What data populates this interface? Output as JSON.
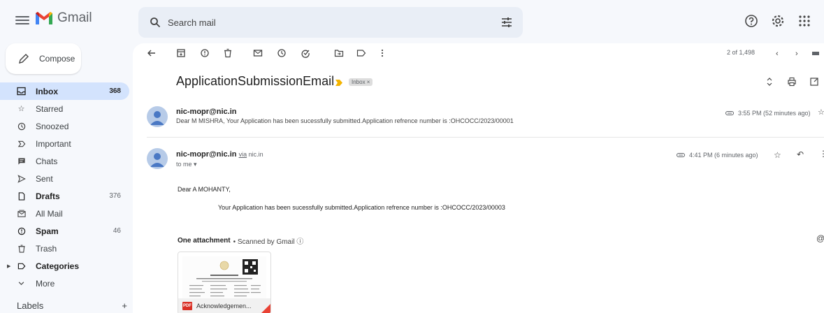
{
  "app": {
    "name": "Gmail"
  },
  "search": {
    "placeholder": "Search mail"
  },
  "compose": {
    "label": "Compose"
  },
  "sidebar": {
    "items": [
      {
        "label": "Inbox",
        "count": "368",
        "icon": "inbox-icon"
      },
      {
        "label": "Starred",
        "count": "",
        "icon": "star-icon"
      },
      {
        "label": "Snoozed",
        "count": "",
        "icon": "clock-icon"
      },
      {
        "label": "Important",
        "count": "",
        "icon": "important-icon"
      },
      {
        "label": "Chats",
        "count": "",
        "icon": "chat-icon"
      },
      {
        "label": "Sent",
        "count": "",
        "icon": "send-icon"
      },
      {
        "label": "Drafts",
        "count": "376",
        "icon": "draft-icon"
      },
      {
        "label": "All Mail",
        "count": "",
        "icon": "all-mail-icon"
      },
      {
        "label": "Spam",
        "count": "46",
        "icon": "spam-icon"
      },
      {
        "label": "Trash",
        "count": "",
        "icon": "trash-icon"
      },
      {
        "label": "Categories",
        "count": "",
        "icon": "label-icon"
      },
      {
        "label": "More",
        "count": "",
        "icon": "chevron-down-icon"
      }
    ],
    "labels_heading": "Labels",
    "labels_add": "+"
  },
  "toolbar": {
    "pager": "2 of 1,498"
  },
  "thread": {
    "subject": "ApplicationSubmissionEmail",
    "tag": "Inbox ×",
    "messages": [
      {
        "sender": "nic-mopr@nic.in",
        "snippet": "Dear M MISHRA, Your Application has been sucessfully submitted.Application refrence number is :OHCOCC/2023/00001",
        "time": "3:55 PM (52 minutes ago)"
      },
      {
        "sender": "nic-mopr@nic.in",
        "via_word": "via",
        "via_domain": "nic.in",
        "to": "to me ▾",
        "time": "4:41 PM (6 minutes ago)",
        "greeting": "Dear  A MOHANTY,",
        "body": "Your Application has been sucessfully submitted.Application refrence number is :OHCOCC/2023/00003"
      }
    ],
    "attachment": {
      "heading": "One attachment",
      "scanned": "• Scanned by Gmail ⓘ",
      "badge": "PDF",
      "name": "Acknowledgemen..."
    }
  },
  "colors": {
    "accent": "#d3e3fd",
    "search_bg": "#e9eef6",
    "important": "#f4b400",
    "pdf_red": "#d93025"
  }
}
